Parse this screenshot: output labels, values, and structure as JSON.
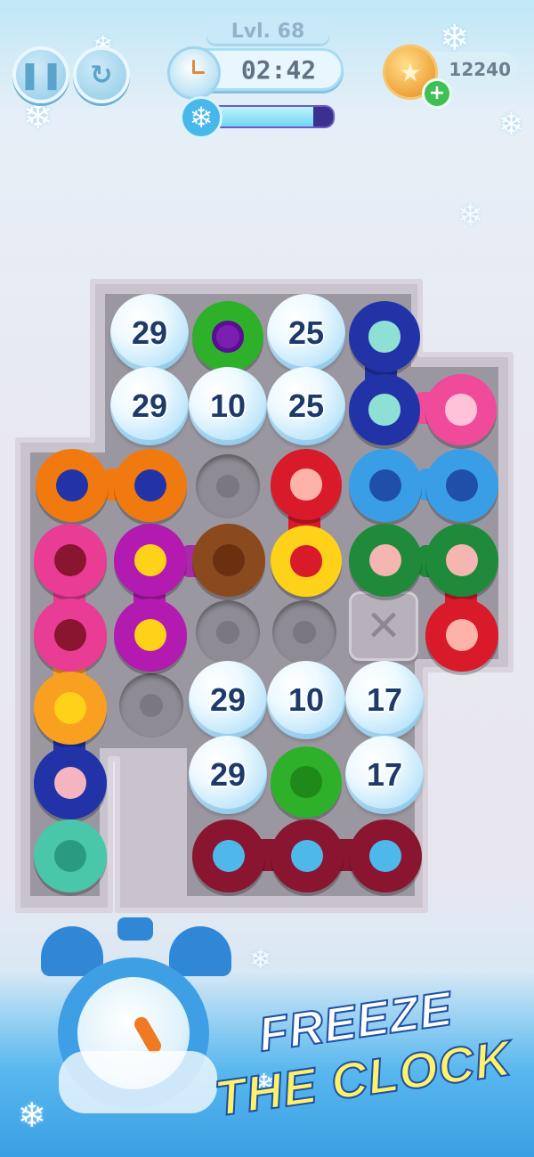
{
  "hud": {
    "level": "Lvl. 68",
    "timer": "02:42",
    "coins": "12240",
    "freeze_progress": 0.85,
    "pause_icon": "pause-icon",
    "restart_icon": "restart-icon",
    "coin_icon": "star-coin-icon",
    "plus_icon": "plus-icon"
  },
  "board": {
    "iced_counters": [
      "29",
      "25",
      "29",
      "10",
      "25",
      "29",
      "10",
      "17",
      "29",
      "17"
    ],
    "blocked_cell_icon": "x-icon"
  },
  "promo": {
    "line1": "FREEZE",
    "line2": "THE CLOCK",
    "icon": "alarm-clock-icon"
  },
  "colors": {
    "board": "#9b97a1",
    "board_border": "#c8c3cd",
    "ice_text": "#1d3a6b",
    "accent_blue": "#3f9fe5",
    "promo_yellow": "#fff26a"
  }
}
